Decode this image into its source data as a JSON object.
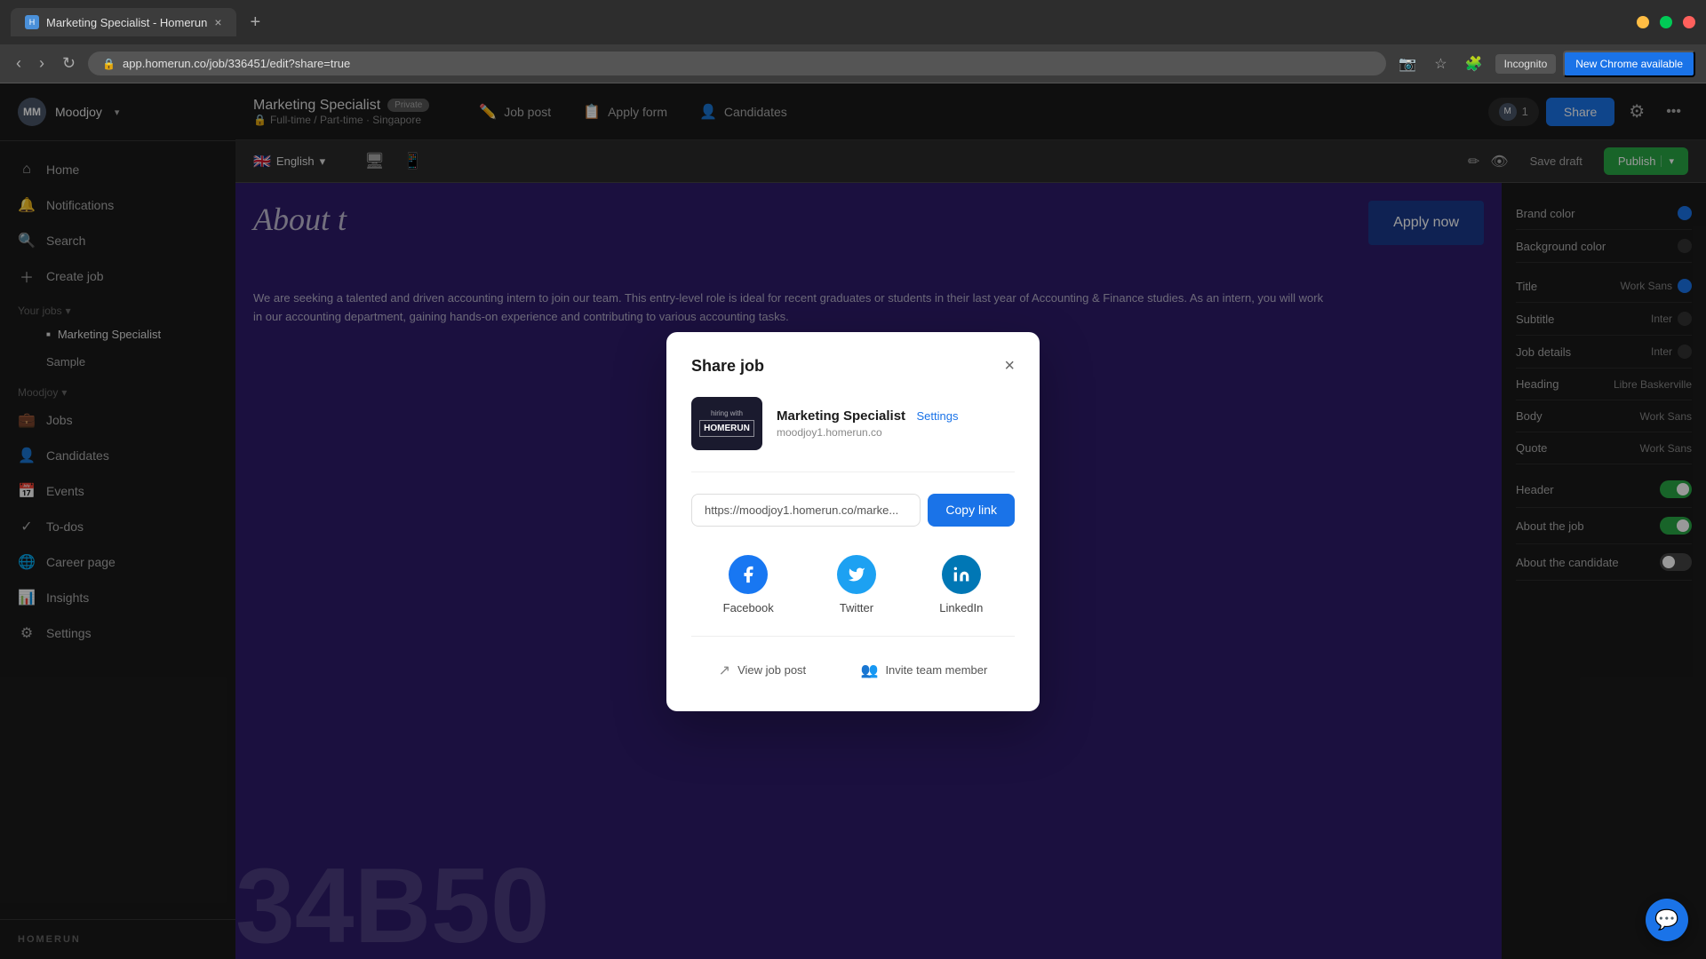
{
  "browser": {
    "tab_title": "Marketing Specialist - Homerun",
    "tab_close": "×",
    "new_tab": "+",
    "address": "app.homerun.co/job/336451/edit?share=true",
    "incognito_label": "Incognito",
    "new_chrome_label": "New Chrome available",
    "minimize": "−",
    "maximize": "□",
    "close": "×"
  },
  "app_header": {
    "job_title": "Marketing Specialist",
    "private_badge": "Private",
    "job_meta": "Full-time / Part-time · Singapore",
    "tabs": [
      {
        "id": "job-post",
        "label": "Job post",
        "icon": "✏️"
      },
      {
        "id": "apply-form",
        "label": "Apply form",
        "icon": "📋"
      },
      {
        "id": "candidates",
        "label": "Candidates",
        "icon": "👤"
      }
    ],
    "user_count": "1",
    "share_label": "Share",
    "company_name": "Moodjoy"
  },
  "sidebar": {
    "avatar_initials": "MM",
    "company_name": "Moodjoy",
    "nav_items": [
      {
        "id": "home",
        "label": "Home",
        "icon": "⌂"
      },
      {
        "id": "notifications",
        "label": "Notifications",
        "icon": "🔔"
      },
      {
        "id": "search",
        "label": "Search",
        "icon": "🔍"
      },
      {
        "id": "create-job",
        "label": "Create job",
        "icon": "+"
      }
    ],
    "your_jobs_label": "Your jobs",
    "jobs_list": [
      {
        "id": "marketing-specialist",
        "label": "Marketing Specialist",
        "active": true
      },
      {
        "id": "sample",
        "label": "Sample"
      }
    ],
    "moodjoy_label": "Moodjoy",
    "moodjoy_nav": [
      {
        "id": "jobs",
        "label": "Jobs",
        "icon": "💼"
      },
      {
        "id": "candidates",
        "label": "Candidates",
        "icon": "👤"
      },
      {
        "id": "events",
        "label": "Events",
        "icon": "📅"
      },
      {
        "id": "to-dos",
        "label": "To-dos",
        "icon": "✓"
      },
      {
        "id": "career-page",
        "label": "Career page",
        "icon": "🌐"
      },
      {
        "id": "insights",
        "label": "Insights",
        "icon": "📊"
      },
      {
        "id": "settings",
        "label": "Settings",
        "icon": "⚙"
      }
    ],
    "logo_text": "HOMERUN"
  },
  "toolbar": {
    "language": "English",
    "flag_emoji": "🇬🇧",
    "desktop_icon": "🖥",
    "mobile_icon": "📱",
    "save_draft_label": "Save draft",
    "publish_label": "Publish",
    "edit_icon": "✏",
    "view_icon": "👁"
  },
  "canvas": {
    "apply_now_label": "Apply now",
    "about_text": "About t",
    "numbers_text": "34B50",
    "body_text": "We are seeking a talented and driven accounting intern to join our team. This entry-level role is ideal for recent graduates or students in their last year of Accounting & Finance studies. As an intern, you will work in our accounting department, gaining hands-on experience and contributing to various accounting tasks."
  },
  "right_panel": {
    "brand_color_label": "Brand color",
    "background_color_label": "Background color",
    "title_label": "Title",
    "title_font": "Work Sans",
    "subtitle_label": "Subtitle",
    "subtitle_font": "Inter",
    "job_details_label": "Job details",
    "job_details_font": "Inter",
    "heading_label": "Heading",
    "heading_font": "Libre Baskerville",
    "body_label": "Body",
    "body_font": "Work Sans",
    "quote_label": "Quote",
    "quote_font": "Work Sans",
    "header_label": "Header",
    "about_job_label": "About the job",
    "about_candidate_label": "About the candidate"
  },
  "modal": {
    "title": "Share job",
    "close_icon": "×",
    "job_title": "Marketing Specialist",
    "settings_link": "Settings",
    "job_url": "moodjoy1.homerun.co",
    "thumbnail_text": "hiring with\nHOMERUN",
    "link_url": "https://moodjoy1.homerun.co/marke...",
    "copy_link_label": "Copy link",
    "facebook_label": "Facebook",
    "twitter_label": "Twitter",
    "linkedin_label": "LinkedIn",
    "view_job_post_label": "View job post",
    "invite_team_label": "Invite team member",
    "facebook_icon": "f",
    "twitter_icon": "𝕏",
    "linkedin_icon": "in"
  },
  "colors": {
    "brand": "#1a73e8",
    "bg_dark": "#333333",
    "canvas_bg": "#2d1b69"
  }
}
